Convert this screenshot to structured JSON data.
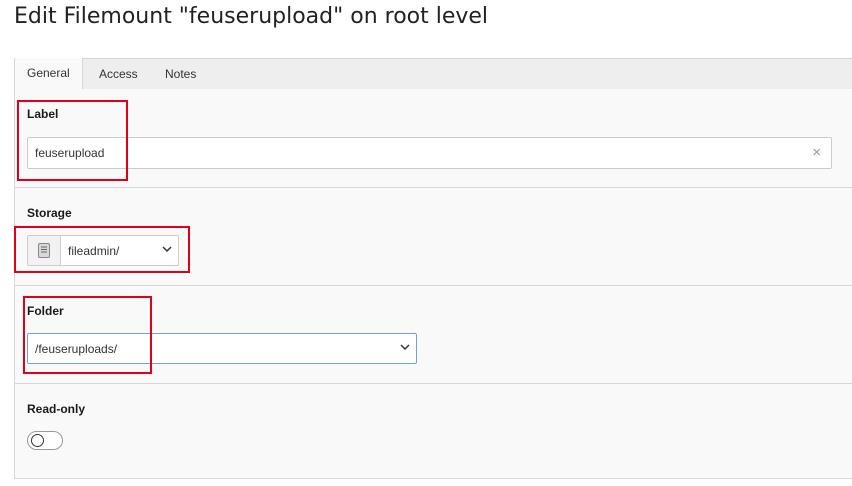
{
  "page": {
    "title": "Edit Filemount \"feuserupload\" on root level"
  },
  "tabs": [
    {
      "label": "General",
      "active": true
    },
    {
      "label": "Access",
      "active": false
    },
    {
      "label": "Notes",
      "active": false
    }
  ],
  "form": {
    "label_field": {
      "label": "Label",
      "value": "feuserupload",
      "clear_icon": "×"
    },
    "storage_field": {
      "label": "Storage",
      "value": "fileadmin/",
      "icon": "storage-icon"
    },
    "folder_field": {
      "label": "Folder",
      "value": "/feuseruploads/"
    },
    "readonly_field": {
      "label": "Read-only",
      "checked": false
    }
  },
  "colors": {
    "highlight": "#e0001b",
    "focus_border": "#6aa5e0"
  }
}
